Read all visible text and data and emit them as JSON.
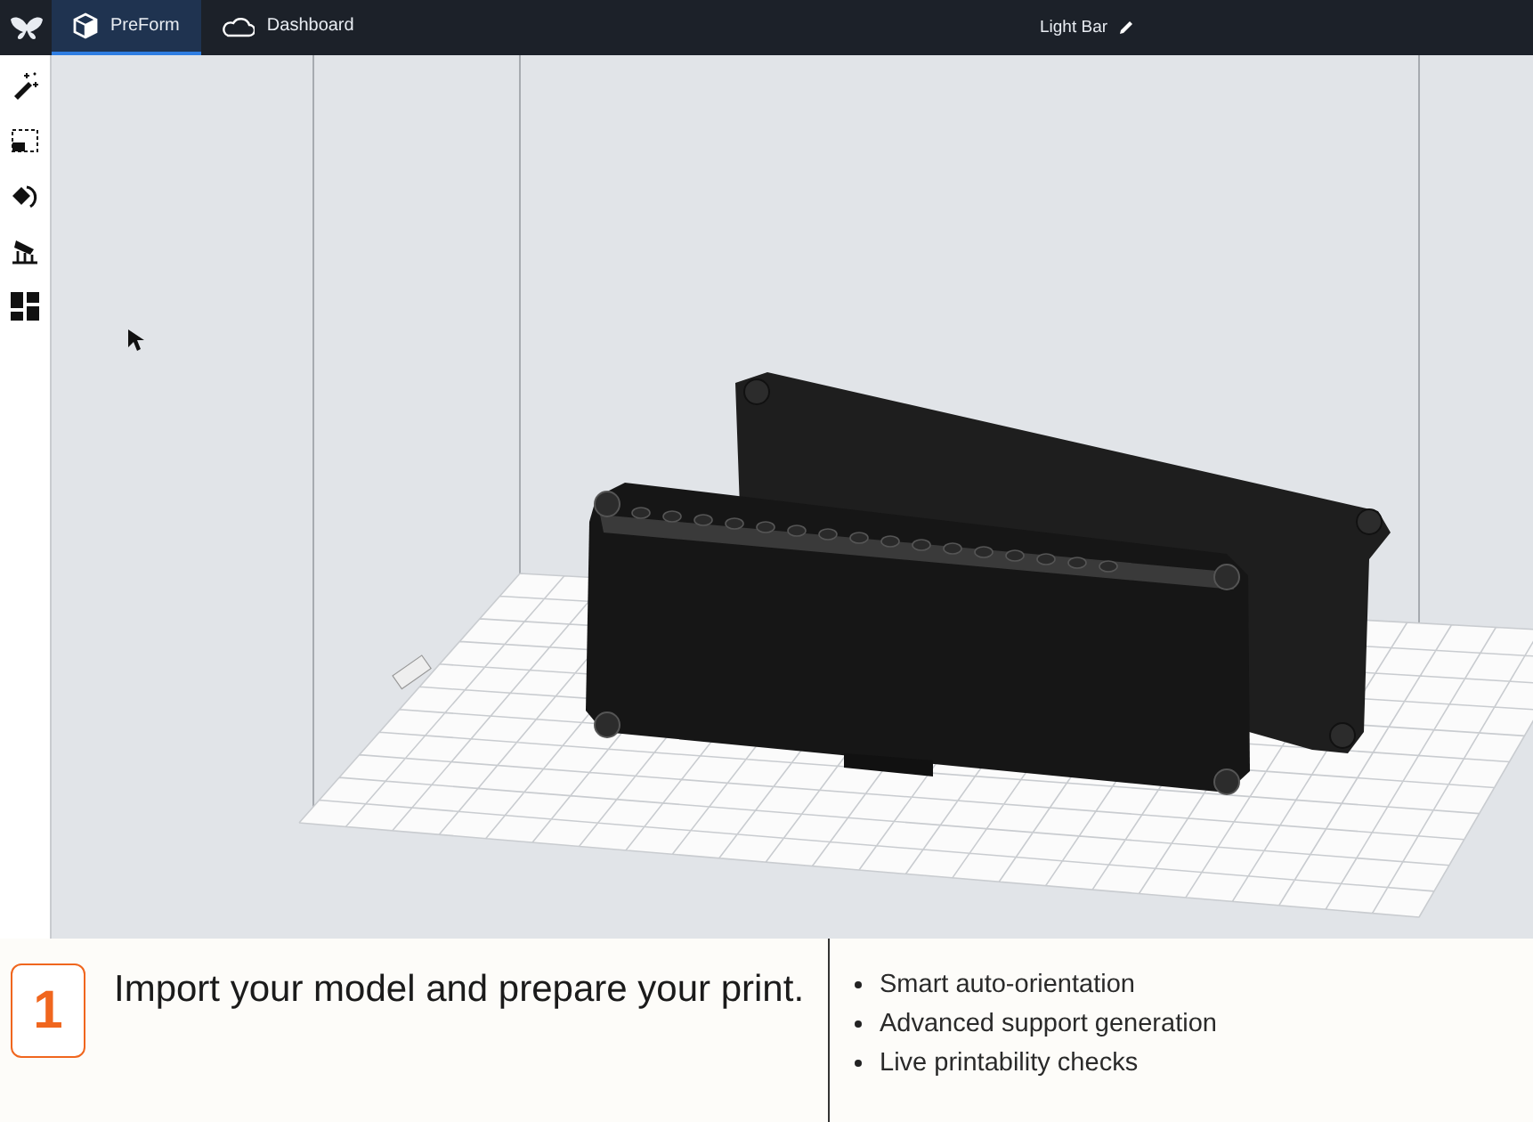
{
  "app_bar": {
    "tabs": [
      {
        "label": "PreForm",
        "selected": true
      },
      {
        "label": "Dashboard",
        "selected": false
      }
    ],
    "document_title": "Light Bar"
  },
  "step": {
    "number": "1",
    "heading": "Import your model and prepare your print.",
    "features": [
      "Smart auto-orientation",
      "Advanced support generation",
      "Live printability checks"
    ]
  }
}
